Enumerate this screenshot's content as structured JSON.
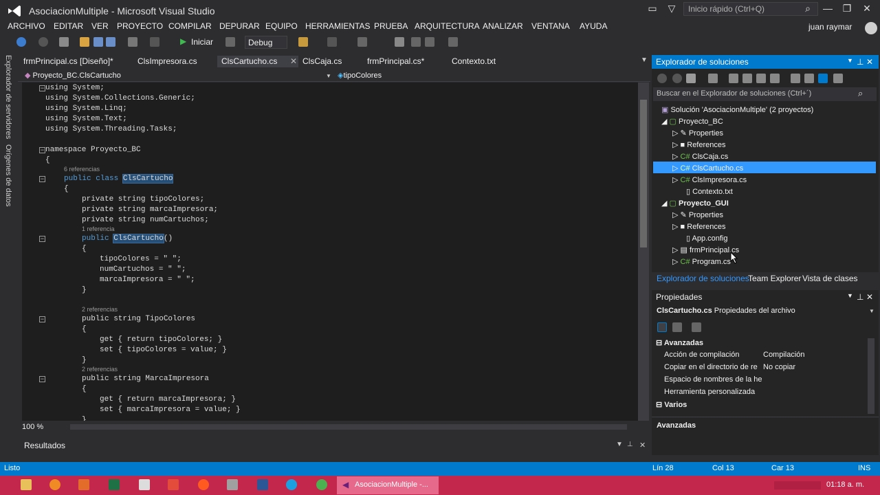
{
  "window": {
    "title": "AsociacionMultiple - Microsoft Visual Studio",
    "quick_launch": "Inicio rápido (Ctrl+Q)",
    "user": "juan raymar"
  },
  "menu": [
    "ARCHIVO",
    "EDITAR",
    "VER",
    "PROYECTO",
    "COMPILAR",
    "DEPURAR",
    "EQUIPO",
    "HERRAMIENTAS",
    "PRUEBA",
    "ARQUITECTURA",
    "ANALIZAR",
    "VENTANA",
    "AYUDA"
  ],
  "toolbar": {
    "start_label": "Iniciar",
    "config": "Debug"
  },
  "left_strip": [
    "Explorador de servidores",
    "Orígenes de datos"
  ],
  "tabs": [
    "frmPrincipal.cs [Diseño]*",
    "ClsImpresora.cs",
    "ClsCartucho.cs",
    "ClsCaja.cs",
    "frmPrincipal.cs*",
    "Contexto.txt"
  ],
  "nav": {
    "left": "Proyecto_BC.ClsCartucho",
    "right": "tipoColores"
  },
  "code": {
    "l1": "using System;",
    "l2": "using System.Collections.Generic;",
    "l3": "using System.Linq;",
    "l4": "using System.Text;",
    "l5": "using System.Threading.Tasks;",
    "ns": "namespace Proyecto_BC",
    "brace_open": "{",
    "brace_close": "}",
    "ref6": "6 referencias",
    "class_decl": "public class ",
    "class_name": "ClsCartucho",
    "f1": "private string tipoColores;",
    "f2": "private string marcaImpresora;",
    "f3": "private string numCartuchos;",
    "ref1": "1 referencia",
    "ctor_pub": "public ",
    "ctor_name": "ClsCartucho",
    "ctor_paren": "()",
    "a1": "tipoColores = \" \";",
    "a2": "numCartuchos = \" \";",
    "a3": "marcaImpresora = \" \";",
    "ref2a": "2 referencias",
    "p1": "public string TipoColores",
    "g1": "get { return tipoColores; }",
    "s1": "set { tipoColores = value; }",
    "ref2b": "2 referencias",
    "p2": "public string MarcaImpresora",
    "g2": "get { return marcaImpresora; }",
    "s2": "set { marcaImpresora = value; }"
  },
  "zoom": "100 %",
  "results_title": "Resultados",
  "solution": {
    "title": "Explorador de soluciones",
    "search": "Buscar en el Explorador de soluciones (Ctrl+´)",
    "root": "Solución 'AsociacionMultiple' (2 proyectos)",
    "p1": "Proyecto_BC",
    "p1_items": [
      "Properties",
      "References",
      "ClsCaja.cs",
      "ClsCartucho.cs",
      "ClsImpresora.cs",
      "Contexto.txt"
    ],
    "p2": "Proyecto_GUI",
    "p2_items": [
      "Properties",
      "References",
      "App.config",
      "frmPrincipal.cs",
      "Program.cs"
    ],
    "bottom_tabs": [
      "Explorador de soluciones",
      "Team Explorer",
      "Vista de clases"
    ]
  },
  "properties": {
    "title": "Propiedades",
    "file": "ClsCartucho.cs",
    "desc": "Propiedades del archivo",
    "cat1": "Avanzadas",
    "rows": [
      {
        "k": "Acción de compilación",
        "v": "Compilación"
      },
      {
        "k": "Copiar en el directorio de re",
        "v": "No copiar"
      },
      {
        "k": "Espacio de nombres de la he",
        "v": ""
      },
      {
        "k": "Herramienta personalizada",
        "v": ""
      }
    ],
    "cat2": "Varios",
    "footer": "Avanzadas"
  },
  "status": {
    "ready": "Listo",
    "line": "Lín 28",
    "col": "Col 13",
    "car": "Car 13",
    "ins": "INS"
  },
  "taskbar": {
    "active": "AsociacionMultiple -...",
    "time": "01:18 a. m."
  },
  "colors": {
    "accent": "#007acc",
    "taskbar": "#c3284c",
    "keyword": "#569cd6"
  }
}
